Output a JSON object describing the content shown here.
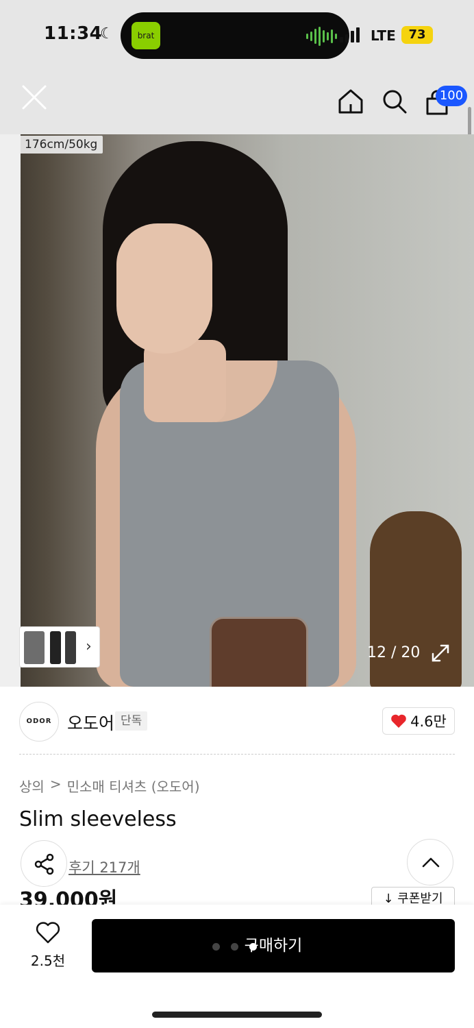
{
  "status_bar": {
    "time": "11:34",
    "dynamic_island_app": "brat",
    "network": "LTE",
    "battery": "73"
  },
  "nav": {
    "cart_badge": "100",
    "icons": [
      "close-icon",
      "home-icon",
      "search-icon",
      "shopping-bag-icon"
    ]
  },
  "gallery": {
    "size_tag": "176cm/50kg",
    "counter": "12 / 20",
    "current_index": 12,
    "total": 20
  },
  "brand": {
    "logo_text": "ODOR",
    "name": "오도어",
    "badge": "단독",
    "likes": "4.6만"
  },
  "product": {
    "breadcrumb_category": "상의",
    "breadcrumb_separator": ">",
    "breadcrumb_subcategory": "민소매 티셔츠 (오도어)",
    "title": "Slim sleeveless",
    "reviews": "후기 217개",
    "price": "39,000원",
    "coupon_label": "↓ 쿠폰받기"
  },
  "bottom_bar": {
    "wish_count": "2.5천",
    "buy_label": "구매하기"
  },
  "colors": {
    "accent_badge": "#1a57ff",
    "heart": "#e8262b",
    "battery": "#f5d30f",
    "buy_button": "#000000"
  }
}
